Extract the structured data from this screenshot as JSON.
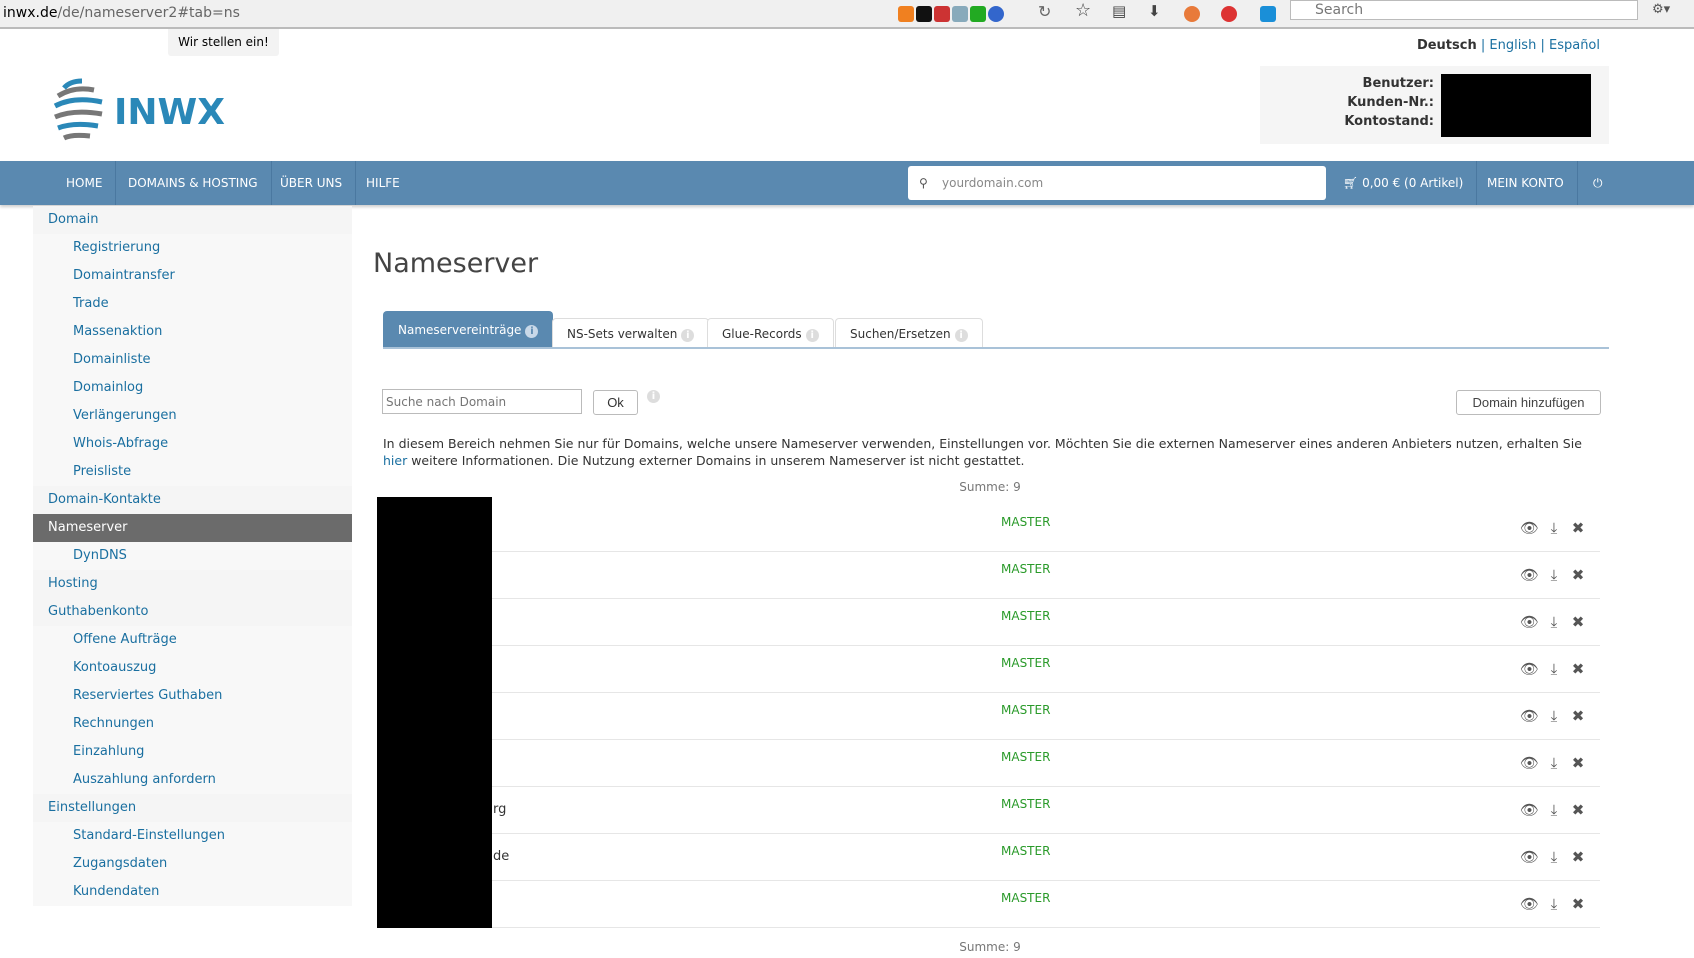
{
  "browser": {
    "url_host": "inwx.de",
    "url_path": "/de/nameserver2#tab=ns",
    "search_placeholder": "Search"
  },
  "header": {
    "jobs_tab": "Wir stellen ein!",
    "languages": [
      "Deutsch",
      "English",
      "Español"
    ],
    "logo_text": "INWX",
    "account": {
      "user_label": "Benutzer:",
      "customer_label": "Kunden-Nr.:",
      "balance_label": "Kontostand:"
    }
  },
  "nav": {
    "items": [
      "HOME",
      "DOMAINS & HOSTING",
      "ÜBER UNS",
      "HILFE"
    ],
    "search_placeholder": "yourdomain.com",
    "cart": "0,00 € (0 Artikel)",
    "account": "MEIN KONTO"
  },
  "sidebar": {
    "items": [
      {
        "label": "Domain",
        "level": 0
      },
      {
        "label": "Registrierung",
        "level": 1
      },
      {
        "label": "Domaintransfer",
        "level": 1
      },
      {
        "label": "Trade",
        "level": 1
      },
      {
        "label": "Massenaktion",
        "level": 1
      },
      {
        "label": "Domainliste",
        "level": 1
      },
      {
        "label": "Domainlog",
        "level": 1
      },
      {
        "label": "Verlängerungen",
        "level": 1
      },
      {
        "label": "Whois-Abfrage",
        "level": 1
      },
      {
        "label": "Preisliste",
        "level": 1
      },
      {
        "label": "Domain-Kontakte",
        "level": 0
      },
      {
        "label": "Nameserver",
        "level": 0,
        "active": true
      },
      {
        "label": "DynDNS",
        "level": 1
      },
      {
        "label": "Hosting",
        "level": 0
      },
      {
        "label": "Guthabenkonto",
        "level": 0
      },
      {
        "label": "Offene Aufträge",
        "level": 1
      },
      {
        "label": "Kontoauszug",
        "level": 1
      },
      {
        "label": "Reserviertes Guthaben",
        "level": 1
      },
      {
        "label": "Rechnungen",
        "level": 1
      },
      {
        "label": "Einzahlung",
        "level": 1
      },
      {
        "label": "Auszahlung anfordern",
        "level": 1
      },
      {
        "label": "Einstellungen",
        "level": 0
      },
      {
        "label": "Standard-Einstellungen",
        "level": 1
      },
      {
        "label": "Zugangsdaten",
        "level": 1
      },
      {
        "label": "Kundendaten",
        "level": 1
      }
    ]
  },
  "main": {
    "title": "Nameserver",
    "tabs": [
      "Nameservereinträge",
      "NS-Sets verwalten",
      "Glue-Records",
      "Suchen/Ersetzen"
    ],
    "search_placeholder": "Suche nach Domain",
    "ok_label": "Ok",
    "add_label": "Domain hinzufügen",
    "info_text_1": "In diesem Bereich nehmen Sie nur für Domains, welche unsere Nameserver verwenden, Einstellungen vor. Möchten Sie die externen Nameserver eines anderen Anbieters nutzen, erhalten Sie ",
    "info_link": "hier",
    "info_text_2": " weitere Informationen. Die Nutzung externer Domains in unserem Nameserver ist nicht gestattet.",
    "sum_label": "Summe: 9",
    "rows": [
      {
        "domain": "",
        "type": "MASTER"
      },
      {
        "domain": "",
        "type": "MASTER"
      },
      {
        "domain": "",
        "type": "MASTER"
      },
      {
        "domain": "",
        "type": "MASTER"
      },
      {
        "domain": "",
        "type": "MASTER"
      },
      {
        "domain": "",
        "type": "MASTER"
      },
      {
        "domain": "rg",
        "type": "MASTER"
      },
      {
        "domain": "de",
        "type": "MASTER"
      },
      {
        "domain": "",
        "type": "MASTER"
      }
    ]
  },
  "colors": {
    "nav": "#5a89b0",
    "link": "#1a6fa0",
    "master": "#2a9a2a"
  }
}
